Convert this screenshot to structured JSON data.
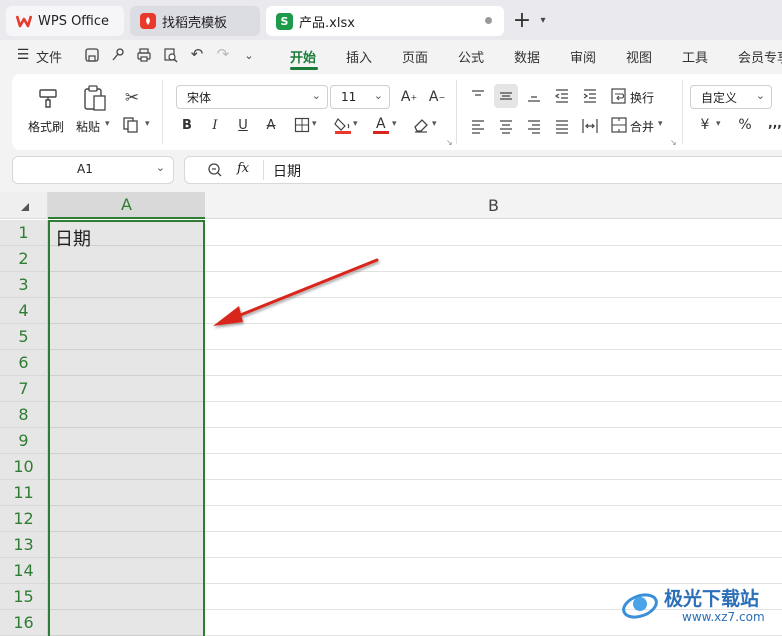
{
  "tabs": {
    "wps": "WPS Office",
    "template": "找稻壳模板",
    "file": "产品.xlsx",
    "file_icon": "S"
  },
  "menu": {
    "file": "文件",
    "items": [
      "开始",
      "插入",
      "页面",
      "公式",
      "数据",
      "审阅",
      "视图",
      "工具",
      "会员专享"
    ]
  },
  "ribbon": {
    "format_painter": "格式刷",
    "paste": "粘贴",
    "font_name": "宋体",
    "font_size": "11",
    "wrap": "换行",
    "merge": "合并",
    "number_format": "自定义",
    "currency": "¥",
    "percent": "%"
  },
  "formula_bar": {
    "cell_ref": "A1",
    "fx": "fx",
    "content": "日期"
  },
  "sheet": {
    "columns": [
      "A",
      "B"
    ],
    "rows": [
      "1",
      "2",
      "3",
      "4",
      "5",
      "6",
      "7",
      "8",
      "9",
      "10",
      "11",
      "12",
      "13",
      "14",
      "15",
      "16"
    ],
    "cell_a1": "日期"
  },
  "watermark": {
    "text": "极光下载站",
    "url": "www.xz7.com"
  },
  "colors": {
    "accent": "#1b7c3a",
    "selection": "#2e7d32",
    "wps_red": "#e8392b",
    "arrow": "#d9261c"
  }
}
